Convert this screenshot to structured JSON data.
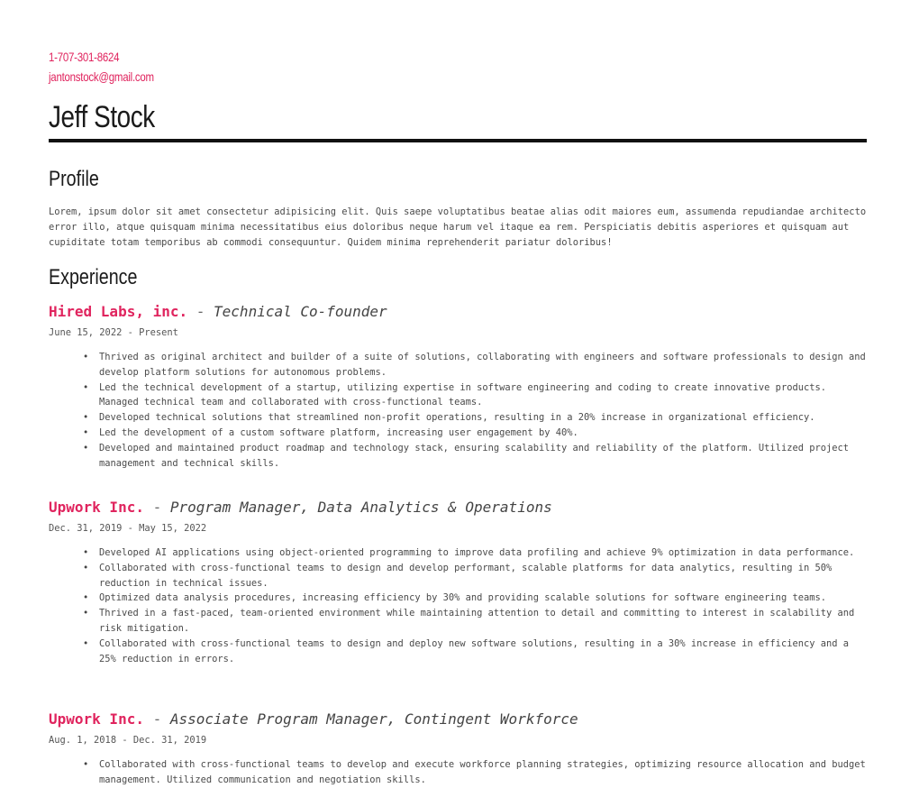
{
  "contact": {
    "phone": "1-707-301-8624",
    "email": "jantonstock@gmail.com"
  },
  "name": "Jeff Stock",
  "profile": {
    "title": "Profile",
    "text": "Lorem, ipsum dolor sit amet consectetur adipisicing elit. Quis saepe voluptatibus beatae alias odit maiores eum, assumenda repudiandae architecto error illo, atque quisquam minima necessitatibus eius doloribus neque harum vel itaque ea rem. Perspiciatis debitis asperiores et quisquam aut cupiditate totam temporibus ab commodi consequuntur. Quidem minima reprehenderit pariatur doloribus!"
  },
  "experience": {
    "title": "Experience",
    "jobs": [
      {
        "company": "Hired Labs, inc.",
        "separator": " - ",
        "role": "Technical Co-founder",
        "dates": "June 15, 2022 - Present",
        "bullets": [
          "Thrived as original architect and builder of a suite of solutions, collaborating with engineers and software professionals to design and develop platform solutions for autonomous problems.",
          "Led the technical development of a startup, utilizing expertise in software engineering and coding to create innovative products. Managed technical team and collaborated with cross-functional teams.",
          "Developed technical solutions that streamlined non-profit operations, resulting in a 20% increase in organizational efficiency.",
          "Led the development of a custom software platform, increasing user engagement by 40%.",
          "Developed and maintained product roadmap and technology stack, ensuring scalability and reliability of the platform. Utilized project management and technical skills."
        ]
      },
      {
        "company": "Upwork Inc.",
        "separator": " - ",
        "role": "Program Manager, Data Analytics & Operations",
        "dates": "Dec. 31, 2019 - May 15, 2022",
        "bullets": [
          "Developed AI applications using object-oriented programming to improve data profiling and achieve 9% optimization in data performance.",
          "Collaborated with cross-functional teams to design and develop performant, scalable platforms for data analytics, resulting in 50% reduction in technical issues.",
          "Optimized data analysis procedures, increasing efficiency by 30% and providing scalable solutions for software engineering teams.",
          "Thrived in a fast-paced, team-oriented environment while maintaining attention to detail and committing to interest in scalability and risk mitigation.",
          "Collaborated with cross-functional teams to design and deploy new software solutions, resulting in a 30% increase in efficiency and a 25% reduction in errors."
        ]
      },
      {
        "company": "Upwork Inc.",
        "separator": " - ",
        "role": "Associate Program Manager, Contingent Workforce",
        "dates": "Aug. 1, 2018 - Dec. 31, 2019",
        "bullets": [
          "Collaborated with cross-functional teams to develop and execute workforce planning strategies, optimizing resource allocation and budget management. Utilized communication and negotiation skills."
        ]
      }
    ]
  }
}
